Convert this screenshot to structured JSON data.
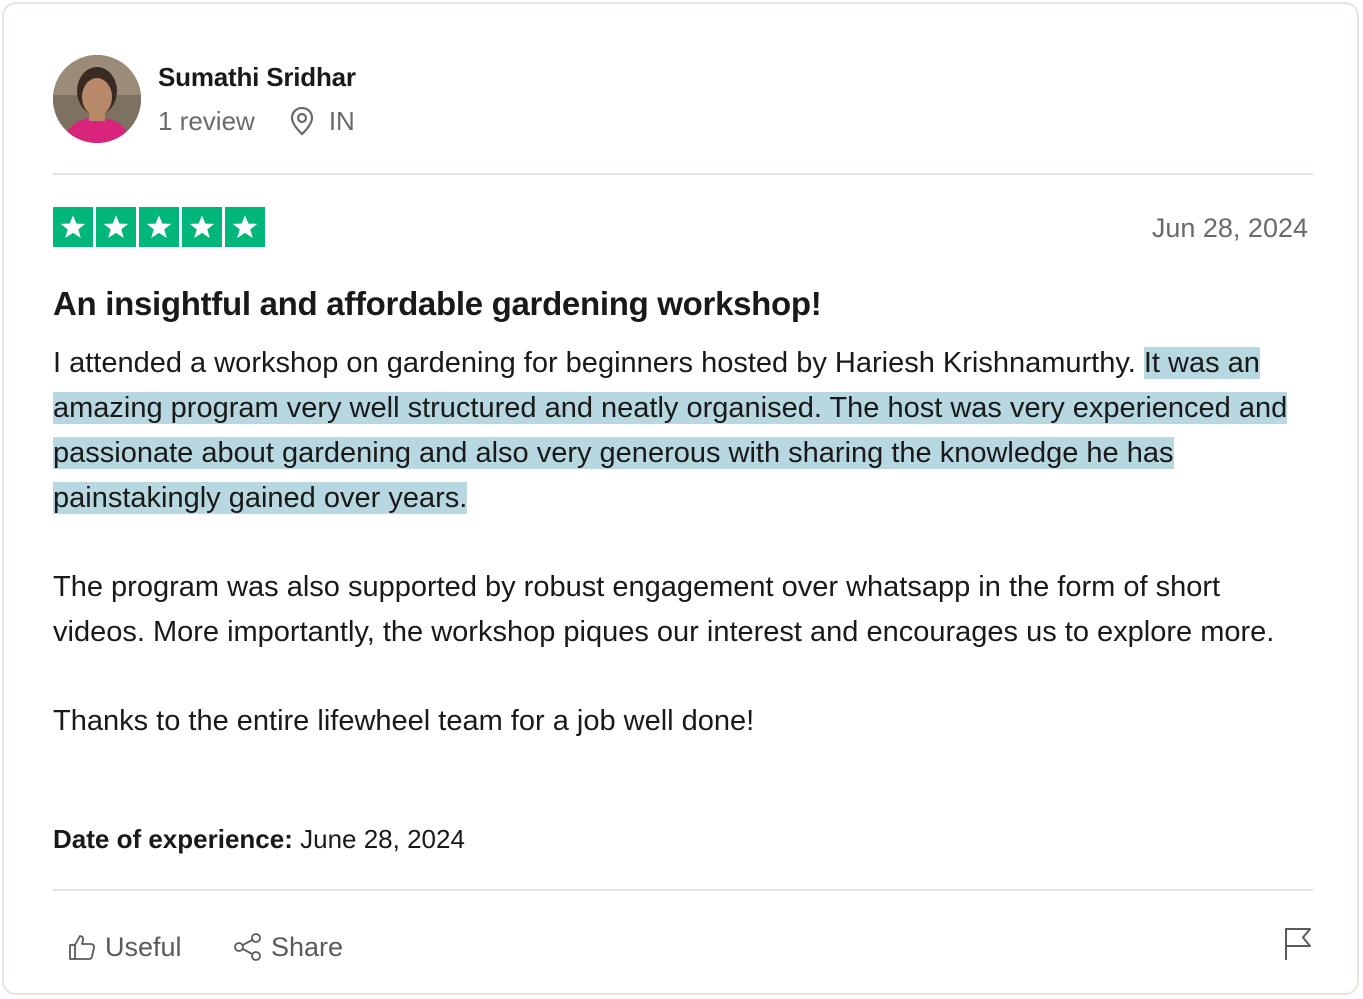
{
  "reviewer": {
    "name": "Sumathi Sridhar",
    "review_count": "1 review",
    "location": "IN"
  },
  "rating": {
    "stars": 5,
    "max": 5,
    "color": "#00b67a"
  },
  "review": {
    "date": "Jun 28, 2024",
    "title": "An insightful and affordable gardening workshop!",
    "paragraph1_plain": "I attended a workshop on gardening for beginners hosted by Hariesh Krishnamurthy. ",
    "paragraph1_highlighted": "It was an amazing program very well structured and neatly organised. The host was very experienced and passionate about gardening and also very generous with sharing the knowledge he has painstakingly gained over years.",
    "paragraph2": "The program was also supported by robust engagement over whatsapp in the form of short videos. More importantly, the workshop piques our interest and encourages us to explore more.",
    "paragraph3": "Thanks to the entire lifewheel team for a job well done!",
    "experience_label": "Date of experience:",
    "experience_date": "June 28, 2024"
  },
  "actions": {
    "useful_label": "Useful",
    "share_label": "Share"
  },
  "icons": {
    "location": "location-pin-icon",
    "useful": "thumbs-up-icon",
    "share": "share-icon",
    "report": "flag-icon"
  },
  "colors": {
    "selection_highlight": "#b8d8e1",
    "text": "#191919",
    "muted": "#6a6a6a",
    "border": "#e5e5dd"
  }
}
